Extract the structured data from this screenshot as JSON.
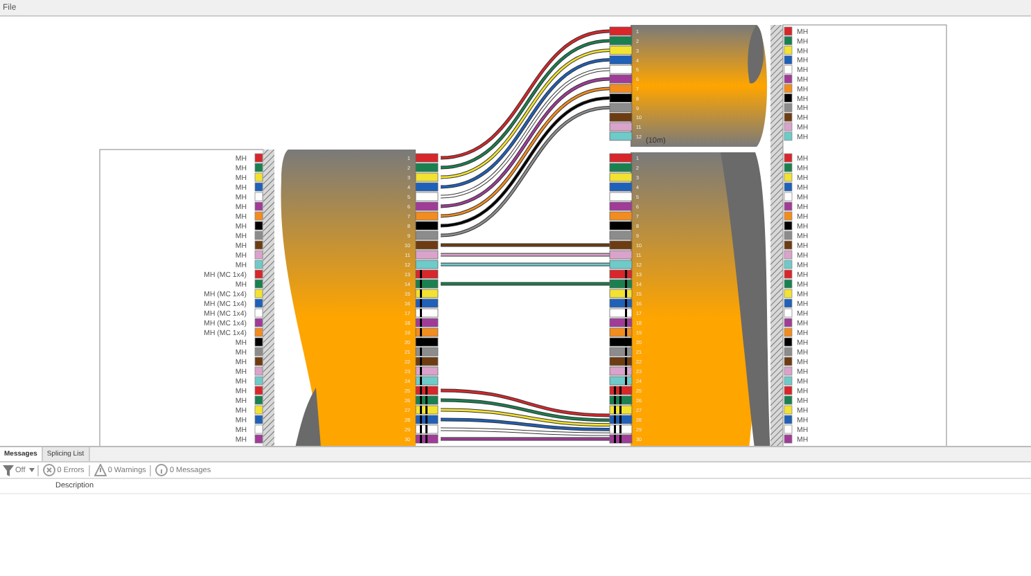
{
  "menu": [
    "File"
  ],
  "left_panel": {
    "rows": [
      {
        "label": "MH",
        "color": "#d8262a"
      },
      {
        "label": "MH",
        "color": "#1a8050"
      },
      {
        "label": "MH",
        "color": "#f2e232"
      },
      {
        "label": "MH",
        "color": "#1f60b8"
      },
      {
        "label": "MH",
        "color": "#ffffff"
      },
      {
        "label": "MH",
        "color": "#a03c98"
      },
      {
        "label": "MH",
        "color": "#f28c1e"
      },
      {
        "label": "MH",
        "color": "#000000"
      },
      {
        "label": "MH",
        "color": "#8c8c8c"
      },
      {
        "label": "MH",
        "color": "#6e3c12"
      },
      {
        "label": "MH",
        "color": "#d9a3cb"
      },
      {
        "label": "MH",
        "color": "#6fcaca"
      },
      {
        "label": "MH (MC 1x4)",
        "color": "#d8262a"
      },
      {
        "label": "MH",
        "color": "#1a8050"
      },
      {
        "label": "MH (MC 1x4)",
        "color": "#f2e232"
      },
      {
        "label": "MH (MC 1x4)",
        "color": "#1f60b8"
      },
      {
        "label": "MH (MC 1x4)",
        "color": "#ffffff"
      },
      {
        "label": "MH (MC 1x4)",
        "color": "#a03c98"
      },
      {
        "label": "MH (MC 1x4)",
        "color": "#f28c1e"
      },
      {
        "label": "MH",
        "color": "#000000"
      },
      {
        "label": "MH",
        "color": "#8c8c8c"
      },
      {
        "label": "MH",
        "color": "#6e3c12"
      },
      {
        "label": "MH",
        "color": "#d9a3cb"
      },
      {
        "label": "MH",
        "color": "#6fcaca"
      },
      {
        "label": "MH",
        "color": "#d8262a"
      },
      {
        "label": "MH",
        "color": "#1a8050"
      },
      {
        "label": "MH",
        "color": "#f2e232"
      },
      {
        "label": "MH",
        "color": "#1f60b8"
      },
      {
        "label": "MH",
        "color": "#ffffff"
      },
      {
        "label": "MH",
        "color": "#a03c98"
      }
    ]
  },
  "left_cable": {
    "tubes": [
      {
        "kind": "plain",
        "fibers": [
          {
            "number": "1",
            "color": "#d8262a",
            "kind": "arched"
          },
          {
            "number": "2",
            "color": "#1a8050",
            "kind": "arched"
          },
          {
            "number": "3",
            "color": "#f2e232",
            "kind": "arched"
          },
          {
            "number": "4",
            "color": "#1f60b8",
            "kind": "arched"
          },
          {
            "number": "5",
            "color": "#ffffff",
            "kind": "arched"
          },
          {
            "number": "6",
            "color": "#a03c98",
            "kind": "arched"
          },
          {
            "number": "7",
            "color": "#f28c1e",
            "kind": "arched"
          },
          {
            "number": "8",
            "color": "#000000",
            "kind": "arched"
          },
          {
            "number": "9",
            "color": "#8c8c8c",
            "kind": "arched"
          },
          {
            "number": "10",
            "color": "#6e3c12",
            "kind": "straight"
          },
          {
            "number": "11",
            "color": "#d9a3cb",
            "kind": "straight"
          },
          {
            "number": "12",
            "color": "#6fcaca",
            "kind": "straight"
          }
        ]
      },
      {
        "kind": "ringed",
        "fibers": [
          {
            "number": "13",
            "color": "#d8262a",
            "kind": "open"
          },
          {
            "number": "14",
            "color": "#1a8050",
            "kind": "straight"
          },
          {
            "number": "15",
            "color": "#f2e232",
            "kind": "open"
          },
          {
            "number": "16",
            "color": "#1f60b8",
            "kind": "open"
          },
          {
            "number": "17",
            "color": "#ffffff",
            "kind": "open"
          },
          {
            "number": "18",
            "color": "#a03c98",
            "kind": "open"
          },
          {
            "number": "19",
            "color": "#f28c1e",
            "kind": "open"
          },
          {
            "number": "20",
            "color": "#000000",
            "kind": "open"
          },
          {
            "number": "21",
            "color": "#8c8c8c",
            "kind": "open"
          },
          {
            "number": "22",
            "color": "#6e3c12",
            "kind": "open"
          },
          {
            "number": "23",
            "color": "#d9a3cb",
            "kind": "open"
          },
          {
            "number": "24",
            "color": "#6fcaca",
            "kind": "open"
          }
        ]
      },
      {
        "kind": "double",
        "fibers": [
          {
            "number": "25",
            "color": "#d8262a",
            "kind": "dropped"
          },
          {
            "number": "26",
            "color": "#1a8050",
            "kind": "dropped"
          },
          {
            "number": "27",
            "color": "#f2e232",
            "kind": "dropped"
          },
          {
            "number": "28",
            "color": "#1f60b8",
            "kind": "dropped"
          },
          {
            "number": "29",
            "color": "#ffffff",
            "kind": "dropped"
          },
          {
            "number": "30",
            "color": "#a03c98",
            "kind": "dropped"
          }
        ]
      }
    ]
  },
  "top_cable": {
    "length": "(10m)",
    "fibers": [
      {
        "number": "1",
        "color": "#d8262a"
      },
      {
        "number": "2",
        "color": "#1a8050"
      },
      {
        "number": "3",
        "color": "#f2e232"
      },
      {
        "number": "4",
        "color": "#1f60b8"
      },
      {
        "number": "5",
        "color": "#ffffff"
      },
      {
        "number": "6",
        "color": "#a03c98"
      },
      {
        "number": "7",
        "color": "#f28c1e"
      },
      {
        "number": "8",
        "color": "#000000"
      },
      {
        "number": "9",
        "color": "#8c8c8c"
      },
      {
        "number": "10",
        "color": "#6e3c12"
      },
      {
        "number": "11",
        "color": "#d9a3cb"
      },
      {
        "number": "12",
        "color": "#6fcaca"
      }
    ]
  },
  "bottom_cable": {
    "tubes": [
      {
        "kind": "plain",
        "fibers": [
          {
            "number": "1",
            "color": "#d8262a"
          },
          {
            "number": "2",
            "color": "#1a8050"
          },
          {
            "number": "3",
            "color": "#f2e232"
          },
          {
            "number": "4",
            "color": "#1f60b8"
          },
          {
            "number": "5",
            "color": "#ffffff"
          },
          {
            "number": "6",
            "color": "#a03c98"
          },
          {
            "number": "7",
            "color": "#f28c1e"
          },
          {
            "number": "8",
            "color": "#000000"
          },
          {
            "number": "9",
            "color": "#8c8c8c"
          },
          {
            "number": "10",
            "color": "#6e3c12"
          },
          {
            "number": "11",
            "color": "#d9a3cb"
          },
          {
            "number": "12",
            "color": "#6fcaca"
          }
        ]
      },
      {
        "kind": "ringed",
        "fibers": [
          {
            "number": "13",
            "color": "#d8262a"
          },
          {
            "number": "14",
            "color": "#1a8050"
          },
          {
            "number": "15",
            "color": "#f2e232"
          },
          {
            "number": "16",
            "color": "#1f60b8"
          },
          {
            "number": "17",
            "color": "#ffffff"
          },
          {
            "number": "18",
            "color": "#a03c98"
          },
          {
            "number": "19",
            "color": "#f28c1e"
          },
          {
            "number": "20",
            "color": "#000000"
          },
          {
            "number": "21",
            "color": "#8c8c8c"
          },
          {
            "number": "22",
            "color": "#6e3c12"
          },
          {
            "number": "23",
            "color": "#d9a3cb"
          },
          {
            "number": "24",
            "color": "#6fcaca"
          }
        ]
      },
      {
        "kind": "double",
        "fibers": [
          {
            "number": "25",
            "color": "#d8262a"
          },
          {
            "number": "26",
            "color": "#1a8050"
          },
          {
            "number": "27",
            "color": "#f2e232"
          },
          {
            "number": "28",
            "color": "#1f60b8"
          },
          {
            "number": "29",
            "color": "#ffffff"
          },
          {
            "number": "30",
            "color": "#a03c98"
          }
        ]
      }
    ]
  },
  "right_panel": {
    "top_rows": [
      {
        "label": "MH",
        "color": "#d8262a"
      },
      {
        "label": "MH",
        "color": "#1a8050"
      },
      {
        "label": "MH",
        "color": "#f2e232"
      },
      {
        "label": "MH",
        "color": "#1f60b8"
      },
      {
        "label": "MH",
        "color": "#ffffff"
      },
      {
        "label": "MH",
        "color": "#a03c98"
      },
      {
        "label": "MH",
        "color": "#f28c1e"
      },
      {
        "label": "MH",
        "color": "#000000"
      },
      {
        "label": "MH",
        "color": "#8c8c8c"
      },
      {
        "label": "MH",
        "color": "#6e3c12"
      },
      {
        "label": "MH",
        "color": "#d9a3cb"
      },
      {
        "label": "MH",
        "color": "#6fcaca"
      }
    ],
    "bottom_rows": [
      {
        "label": "MH",
        "color": "#d8262a"
      },
      {
        "label": "MH",
        "color": "#1a8050"
      },
      {
        "label": "MH",
        "color": "#f2e232"
      },
      {
        "label": "MH",
        "color": "#1f60b8"
      },
      {
        "label": "MH",
        "color": "#ffffff"
      },
      {
        "label": "MH",
        "color": "#a03c98"
      },
      {
        "label": "MH",
        "color": "#f28c1e"
      },
      {
        "label": "MH",
        "color": "#000000"
      },
      {
        "label": "MH",
        "color": "#8c8c8c"
      },
      {
        "label": "MH",
        "color": "#6e3c12"
      },
      {
        "label": "MH",
        "color": "#d9a3cb"
      },
      {
        "label": "MH",
        "color": "#6fcaca"
      },
      {
        "label": "MH",
        "color": "#d8262a"
      },
      {
        "label": "MH",
        "color": "#1a8050"
      },
      {
        "label": "MH",
        "color": "#f2e232"
      },
      {
        "label": "MH",
        "color": "#1f60b8"
      },
      {
        "label": "MH",
        "color": "#ffffff"
      },
      {
        "label": "MH",
        "color": "#a03c98"
      },
      {
        "label": "MH",
        "color": "#f28c1e"
      },
      {
        "label": "MH",
        "color": "#000000"
      },
      {
        "label": "MH",
        "color": "#8c8c8c"
      },
      {
        "label": "MH",
        "color": "#6e3c12"
      },
      {
        "label": "MH",
        "color": "#d9a3cb"
      },
      {
        "label": "MH",
        "color": "#6fcaca"
      },
      {
        "label": "MH",
        "color": "#d8262a"
      },
      {
        "label": "MH",
        "color": "#1a8050"
      },
      {
        "label": "MH",
        "color": "#f2e232"
      },
      {
        "label": "MH",
        "color": "#1f60b8"
      },
      {
        "label": "MH",
        "color": "#ffffff"
      },
      {
        "label": "MH",
        "color": "#a03c98"
      }
    ]
  },
  "bottom_pane": {
    "tabs": [
      {
        "label": "Messages",
        "selected": true
      },
      {
        "label": "Splicing List",
        "selected": false
      }
    ],
    "filter": "Off",
    "counts": [
      "0 Errors",
      "0 Warnings",
      "0 Messages"
    ],
    "columns": [
      "Description"
    ]
  }
}
